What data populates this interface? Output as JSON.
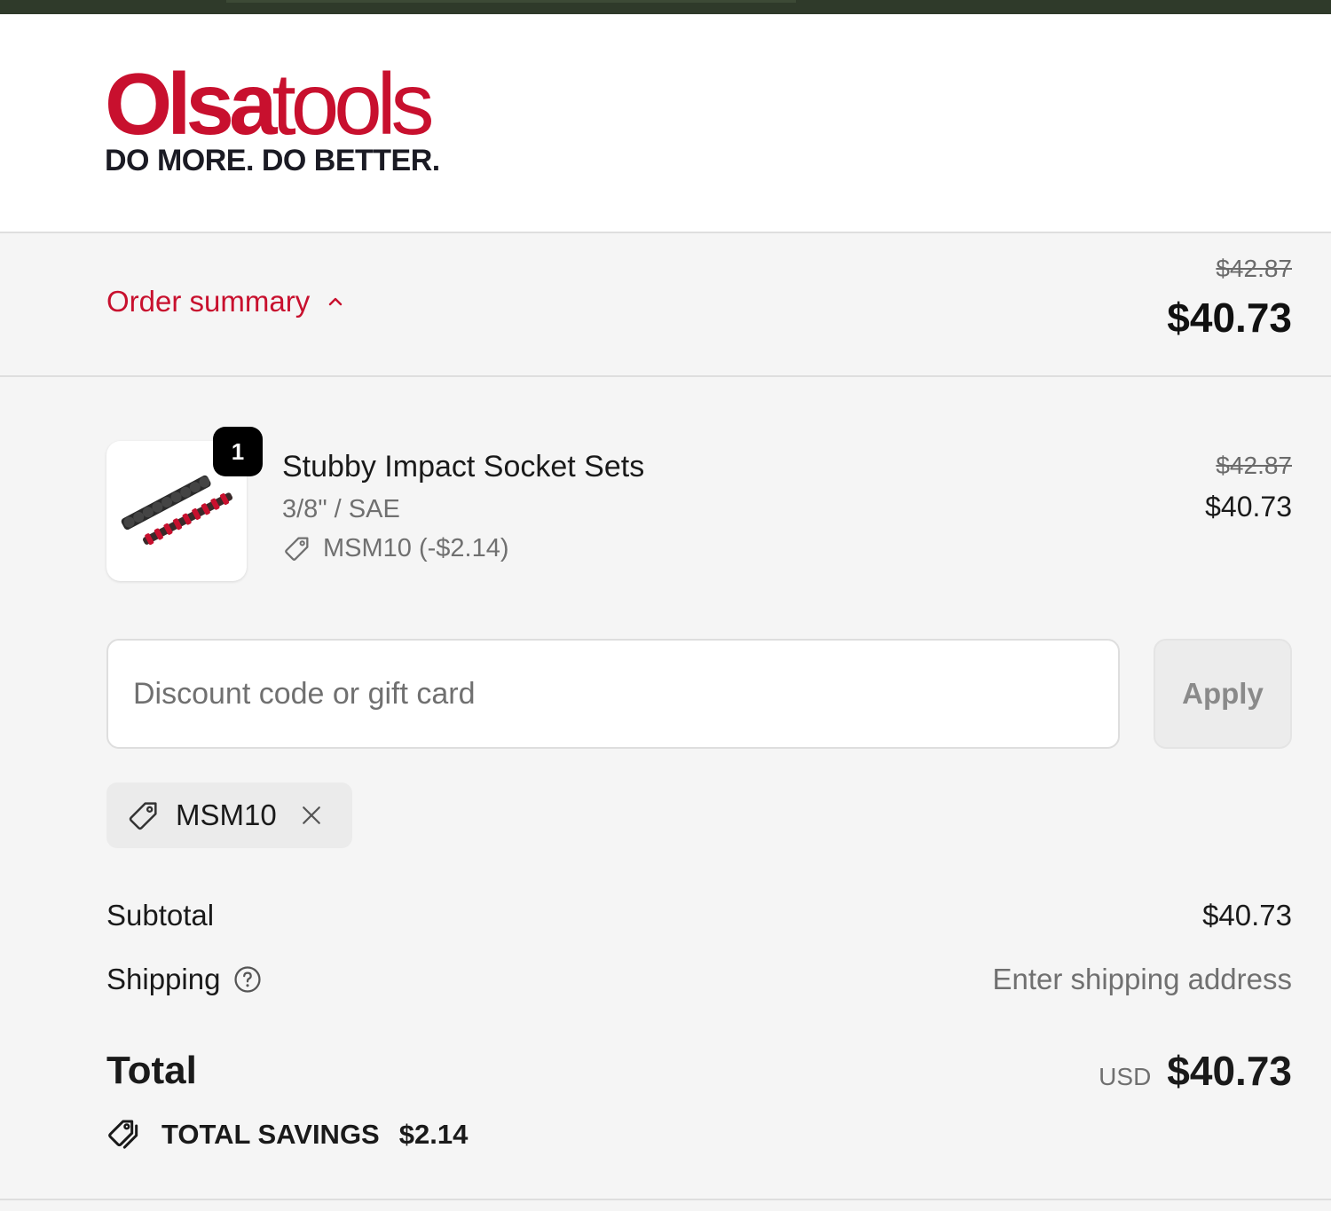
{
  "brand": {
    "logo_bold": "Olsa",
    "logo_light": "tools",
    "tagline": "DO MORE. DO BETTER.",
    "accent_color": "#c8102e"
  },
  "summary": {
    "toggle_label": "Order summary",
    "toggle_icon": "chevron-up-icon",
    "original_total": "$42.87",
    "total": "$40.73"
  },
  "cart": {
    "items": [
      {
        "quantity": "1",
        "name": "Stubby Impact Socket Sets",
        "variant": "3/8\" / SAE",
        "discount": "MSM10 (-$2.14)",
        "original_price": "$42.87",
        "price": "$40.73"
      }
    ]
  },
  "discount": {
    "placeholder": "Discount code or gift card",
    "value": "",
    "apply_label": "Apply",
    "applied_code": "MSM10"
  },
  "totals": {
    "subtotal_label": "Subtotal",
    "subtotal_value": "$40.73",
    "shipping_label": "Shipping",
    "shipping_value": "Enter shipping address",
    "total_label": "Total",
    "currency": "USD",
    "total_value": "$40.73",
    "savings_label": "TOTAL SAVINGS",
    "savings_value": "$2.14"
  }
}
